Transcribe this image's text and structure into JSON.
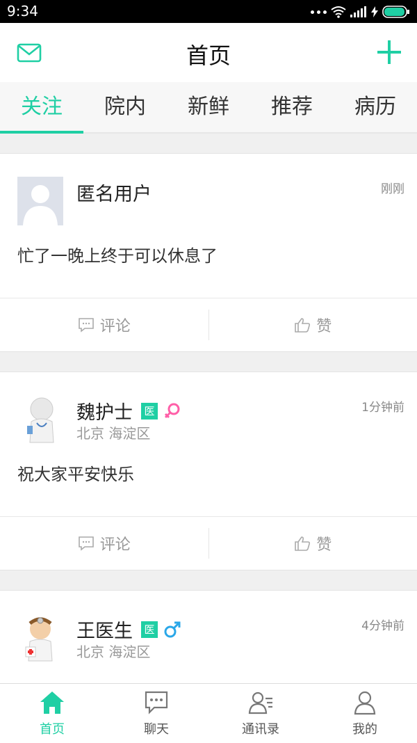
{
  "status_bar": {
    "time": "9:34"
  },
  "header": {
    "title": "首页",
    "left_icon": "mail-icon",
    "right_icon": "plus-icon"
  },
  "tabs": [
    {
      "label": "关注",
      "active": true
    },
    {
      "label": "院内",
      "active": false
    },
    {
      "label": "新鲜",
      "active": false
    },
    {
      "label": "推荐",
      "active": false
    },
    {
      "label": "病历",
      "active": false
    }
  ],
  "posts": [
    {
      "name": "匿名用户",
      "time": "刚刚",
      "content": "忙了一晚上终于可以休息了",
      "comment_label": "评论",
      "like_label": "赞"
    },
    {
      "name": "魏护士",
      "badge": "医",
      "gender": "female",
      "location": "北京 海淀区",
      "time": "1分钟前",
      "content": "祝大家平安快乐",
      "comment_label": "评论",
      "like_label": "赞"
    },
    {
      "name": "王医生",
      "badge": "医",
      "gender": "male",
      "location": "北京 海淀区",
      "time": "4分钟前"
    }
  ],
  "bottom_nav": [
    {
      "label": "首页",
      "icon": "home-icon",
      "active": true
    },
    {
      "label": "聊天",
      "icon": "chat-icon",
      "active": false
    },
    {
      "label": "通讯录",
      "icon": "contacts-icon",
      "active": false
    },
    {
      "label": "我的",
      "icon": "profile-icon",
      "active": false
    }
  ],
  "colors": {
    "accent": "#1fcfa4",
    "female": "#ff5fa8",
    "male": "#2aa7e8"
  }
}
